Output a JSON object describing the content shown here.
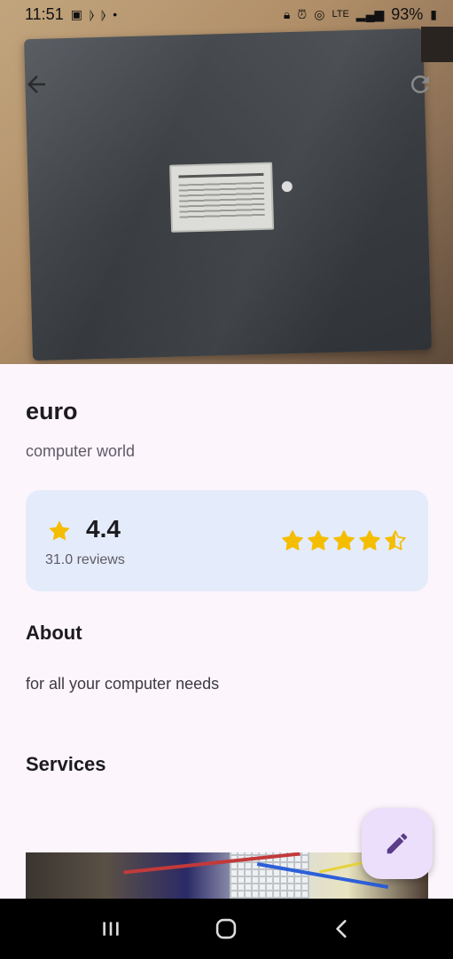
{
  "status_bar": {
    "time": "11:51",
    "battery": "93%",
    "network": "LTE"
  },
  "hero": {
    "back_icon": "arrow-back-icon",
    "refresh_icon": "refresh-icon"
  },
  "business": {
    "name": "euro",
    "category": "computer world"
  },
  "rating": {
    "value": "4.4",
    "reviews": "31.0 reviews",
    "stars_out_of_5": 4.4,
    "star_color": "#f5bd00"
  },
  "about": {
    "title": "About",
    "text": "for all your computer needs"
  },
  "services": {
    "title": "Services"
  },
  "fab": {
    "icon": "edit-pencil-icon",
    "color": "#5b3c88"
  },
  "system_nav": {
    "recents_icon": "recents-icon",
    "home_icon": "home-icon",
    "back_icon": "back-icon"
  }
}
